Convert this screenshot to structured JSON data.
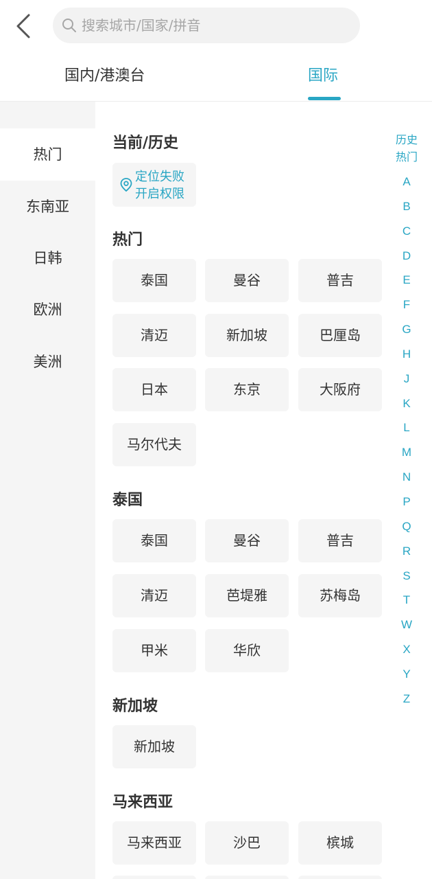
{
  "header": {
    "back_icon": "chevron-left-icon",
    "search_placeholder": "搜索城市/国家/拼音",
    "search_icon": "search-icon"
  },
  "tabs": [
    {
      "label": "国内/港澳台",
      "active": false
    },
    {
      "label": "国际",
      "active": true
    }
  ],
  "accent_color": "#29a6c4",
  "regions": [
    {
      "label": "热门",
      "active": true
    },
    {
      "label": "东南亚",
      "active": false
    },
    {
      "label": "日韩",
      "active": false
    },
    {
      "label": "欧洲",
      "active": false
    },
    {
      "label": "美洲",
      "active": false
    }
  ],
  "current": {
    "title": "当前/历史",
    "location_icon": "location-pin-icon",
    "location_line1": "定位失败",
    "location_line2": "开启权限"
  },
  "sections": [
    {
      "title": "热门",
      "cities": [
        "泰国",
        "曼谷",
        "普吉",
        "清迈",
        "新加坡",
        "巴厘岛",
        "日本",
        "东京",
        "大阪府",
        "马尔代夫"
      ]
    },
    {
      "title": "泰国",
      "cities": [
        "泰国",
        "曼谷",
        "普吉",
        "清迈",
        "芭堤雅",
        "苏梅岛",
        "甲米",
        "华欣"
      ]
    },
    {
      "title": "新加坡",
      "cities": [
        "新加坡"
      ]
    },
    {
      "title": "马来西亚",
      "cities": [
        "马来西亚",
        "沙巴",
        "槟城"
      ]
    }
  ],
  "index_bar": [
    "历史",
    "热门",
    "A",
    "B",
    "C",
    "D",
    "E",
    "F",
    "G",
    "H",
    "J",
    "K",
    "L",
    "M",
    "N",
    "P",
    "Q",
    "R",
    "S",
    "T",
    "W",
    "X",
    "Y",
    "Z"
  ]
}
